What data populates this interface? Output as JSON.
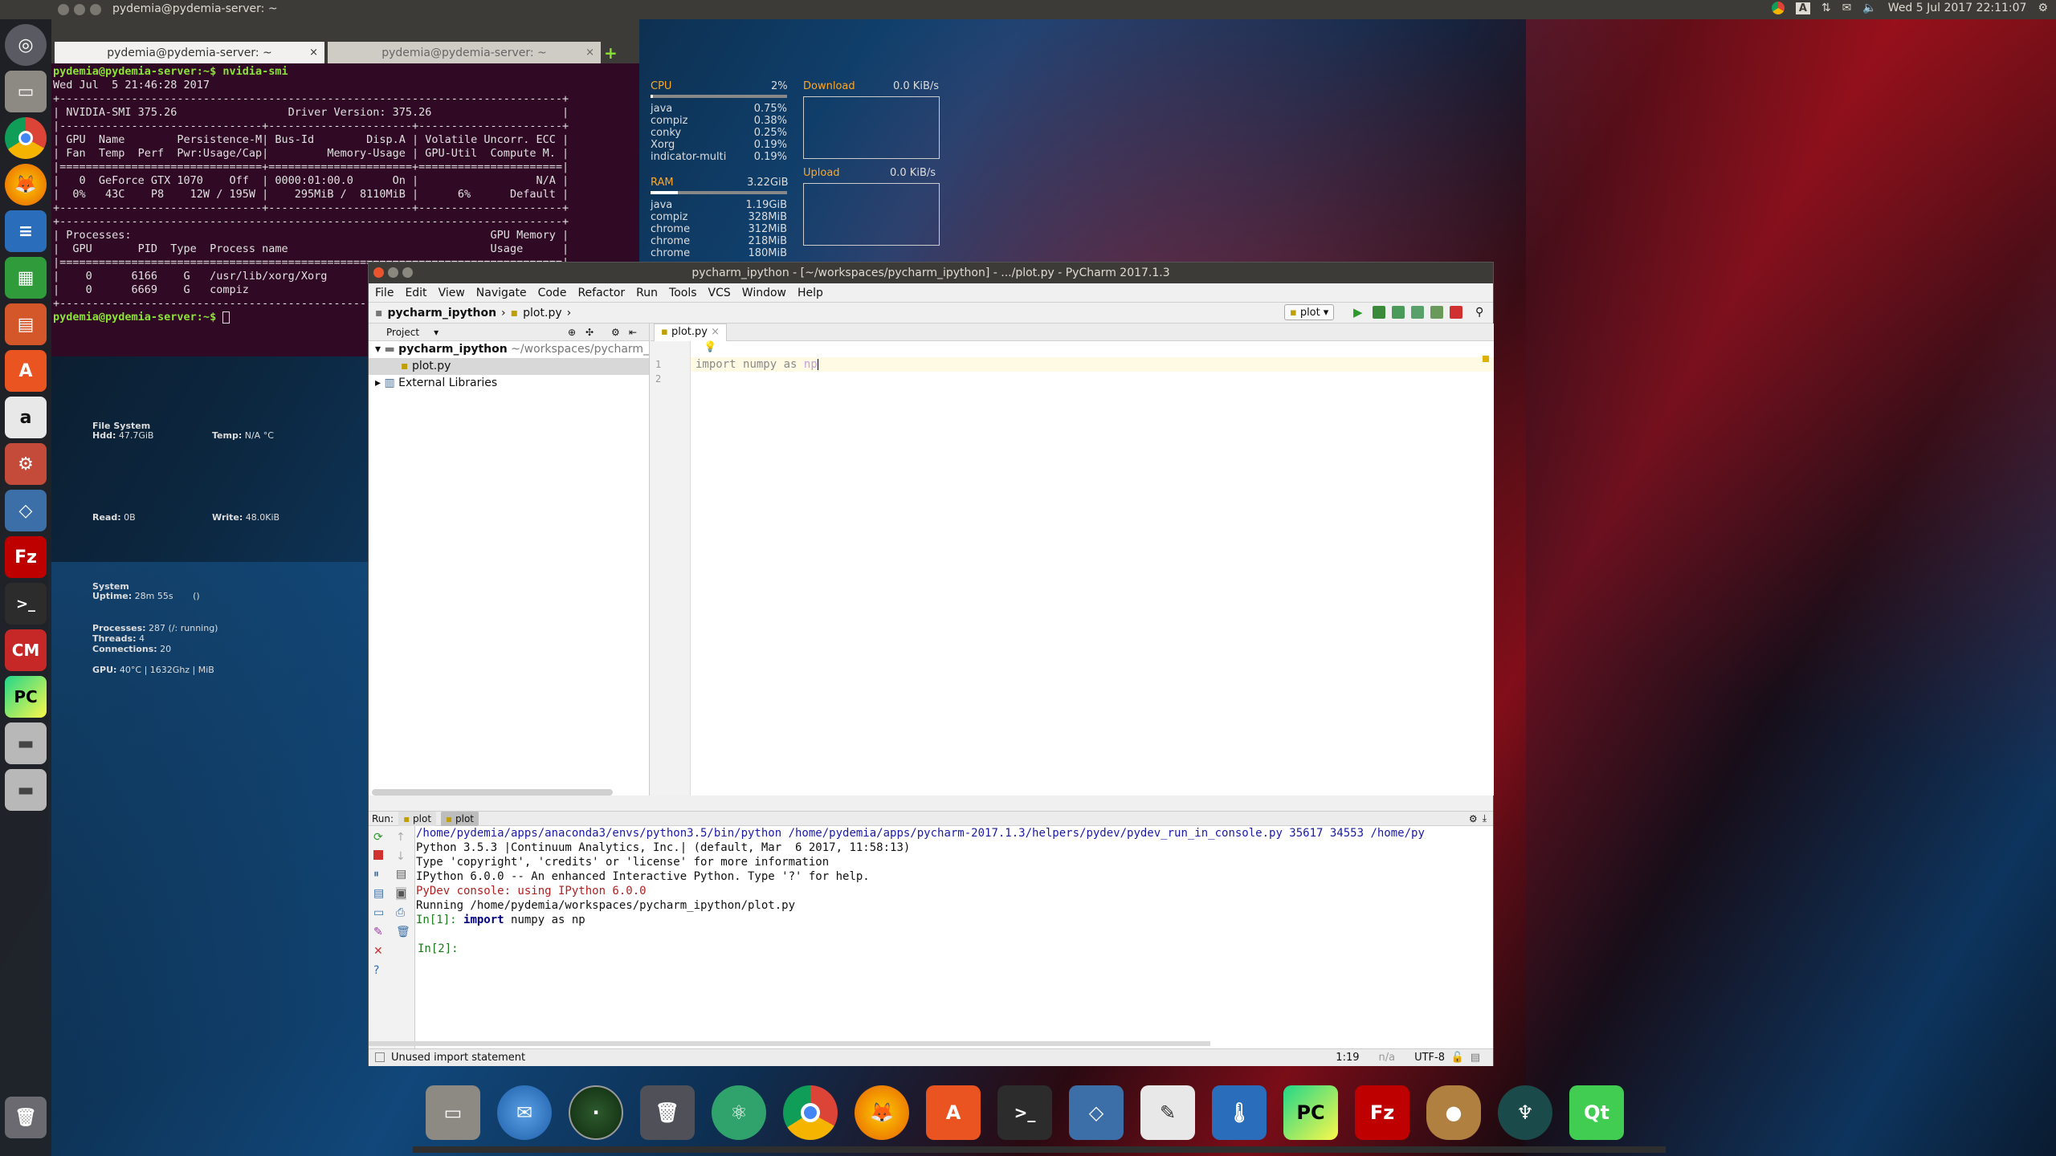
{
  "top_panel": {
    "title": "pydemia@pydemia-server: ~",
    "clock": "Wed 5 Jul 2017 22:11:07"
  },
  "terminal": {
    "tabs": [
      {
        "label": "pydemia@pydemia-server: ~"
      },
      {
        "label": "pydemia@pydemia-server: ~"
      }
    ],
    "lines": [
      "pydemia@pydemia-server:~$ nvidia-smi",
      "Wed Jul  5 21:46:28 2017",
      "+-----------------------------------------------------------------------------+",
      "| NVIDIA-SMI 375.26                 Driver Version: 375.26                    |",
      "|-------------------------------+----------------------+----------------------+",
      "| GPU  Name        Persistence-M| Bus-Id        Disp.A | Volatile Uncorr. ECC |",
      "| Fan  Temp  Perf  Pwr:Usage/Cap|         Memory-Usage | GPU-Util  Compute M. |",
      "|===============================+======================+======================|",
      "|   0  GeForce GTX 1070    Off  | 0000:01:00.0      On |                  N/A |",
      "|  0%   43C    P8    12W / 195W |    295MiB /  8110MiB |      6%      Default |",
      "+-------------------------------+----------------------+----------------------+",
      "",
      "+-----------------------------------------------------------------------------+",
      "| Processes:                                                       GPU Memory |",
      "|  GPU       PID  Type  Process name                               Usage      |",
      "|=============================================================================|",
      "|    0      6166    G   /usr/lib/xorg/Xorg                           193MiB |",
      "|    0      6669    G   compiz                                        98MiB |",
      "+-----------------------------------------------------------------------------+",
      "pydemia@pydemia-server:~$ "
    ]
  },
  "conky": {
    "cpu": {
      "label": "CPU",
      "value": "2%",
      "pct": 0.02,
      "procs": [
        {
          "name": "java",
          "val": "0.75%"
        },
        {
          "name": "compiz",
          "val": "0.38%"
        },
        {
          "name": "conky",
          "val": "0.25%"
        },
        {
          "name": "Xorg",
          "val": "0.19%"
        },
        {
          "name": "indicator-multi",
          "val": "0.19%"
        }
      ]
    },
    "ram": {
      "label": "RAM",
      "value": "3.22GiB",
      "pct": 0.2,
      "procs": [
        {
          "name": "java",
          "val": "1.19GiB"
        },
        {
          "name": "compiz",
          "val": "328MiB"
        },
        {
          "name": "chrome",
          "val": "312MiB"
        },
        {
          "name": "chrome",
          "val": "218MiB"
        },
        {
          "name": "chrome",
          "val": "180MiB"
        }
      ]
    },
    "download": {
      "label": "Download",
      "value": "0.0 KiB/s"
    },
    "upload": {
      "label": "Upload",
      "value": "0.0 KiB/s"
    },
    "fs": {
      "title": "File System",
      "hdd_label": "Hdd:",
      "hdd": "47.7GiB",
      "temp_label": "Temp:",
      "temp": "N/A °C",
      "read_label": "Read:",
      "read": "0B",
      "write_label": "Write:",
      "write": "48.0KiB"
    },
    "system": {
      "title": "System",
      "uptime_label": "Uptime:",
      "uptime": "28m 55s",
      "uptime_extra": "()",
      "proc_label": "Processes:",
      "proc": "287 (/: running)",
      "threads_label": "Threads:",
      "threads": "4",
      "conn_label": "Connections:",
      "conn": "20",
      "gpu_label": "GPU:",
      "gpu": "40°C | 1632Ghz | MiB"
    }
  },
  "pycharm": {
    "title": "pycharm_ipython - [~/workspaces/pycharm_ipython] - .../plot.py - PyCharm 2017.1.3",
    "menu": [
      "File",
      "Edit",
      "View",
      "Navigate",
      "Code",
      "Refactor",
      "Run",
      "Tools",
      "VCS",
      "Window",
      "Help"
    ],
    "breadcrumb": {
      "project": "pycharm_ipython",
      "file": "plot.py"
    },
    "run_config": "plot",
    "project_panel": {
      "header": "Project",
      "root": "pycharm_ipython",
      "root_path": "~/workspaces/pycharm_ipython",
      "file": "plot.py",
      "external": "External Libraries"
    },
    "editor_tab": "plot.py",
    "line_numbers": [
      "1",
      "2"
    ],
    "code": {
      "kw1": "import",
      "mod": "numpy",
      "kw2": "as",
      "alias": "np"
    },
    "run": {
      "label": "Run:",
      "tab1": "plot",
      "tab2": "plot",
      "console": {
        "cmd": "/home/pydemia/apps/anaconda3/envs/python3.5/bin/python /home/pydemia/apps/pycharm-2017.1.3/helpers/pydev/pydev_run_in_console.py 35617 34553 /home/py",
        "l2": "Python 3.5.3 |Continuum Analytics, Inc.| (default, Mar  6 2017, 11:58:13)",
        "l3": "Type 'copyright', 'credits' or 'license' for more information",
        "l4": "IPython 6.0.0 -- An enhanced Interactive Python. Type '?' for help.",
        "l5": "PyDev console: using IPython 6.0.0",
        "l6": "Running /home/pydemia/workspaces/pycharm_ipython/plot.py",
        "in1": "In[1]:",
        "in1_kw": "import",
        "in1_rest": " numpy as np",
        "in2": "In[2]:"
      }
    },
    "status": {
      "message": "Unused import statement",
      "pos": "1:19",
      "na": "n/a",
      "enc": "UTF-8"
    }
  },
  "launcher": [
    "ubuntu-icon",
    "files-icon",
    "chrome-icon",
    "firefox-icon",
    "writer-icon",
    "calc-icon",
    "impress-icon",
    "software-center-icon",
    "amazon-icon",
    "settings-icon",
    "virtualbox-icon",
    "filezilla-icon",
    "terminal-icon",
    "cm-icon",
    "pycharm-icon",
    "drive-icon",
    "drive-icon",
    "trash-icon"
  ],
  "dock": [
    "files-icon",
    "thunderbird-icon",
    "radar-icon",
    "trash-icon",
    "atom-icon",
    "chrome-icon",
    "firefox-icon",
    "software-center-icon",
    "terminal-icon",
    "virtualbox-icon",
    "text-editor-icon",
    "thermometer-icon",
    "pycharm-icon",
    "filezilla-icon",
    "acorn-icon",
    "gitkraken-icon",
    "qt-icon"
  ]
}
